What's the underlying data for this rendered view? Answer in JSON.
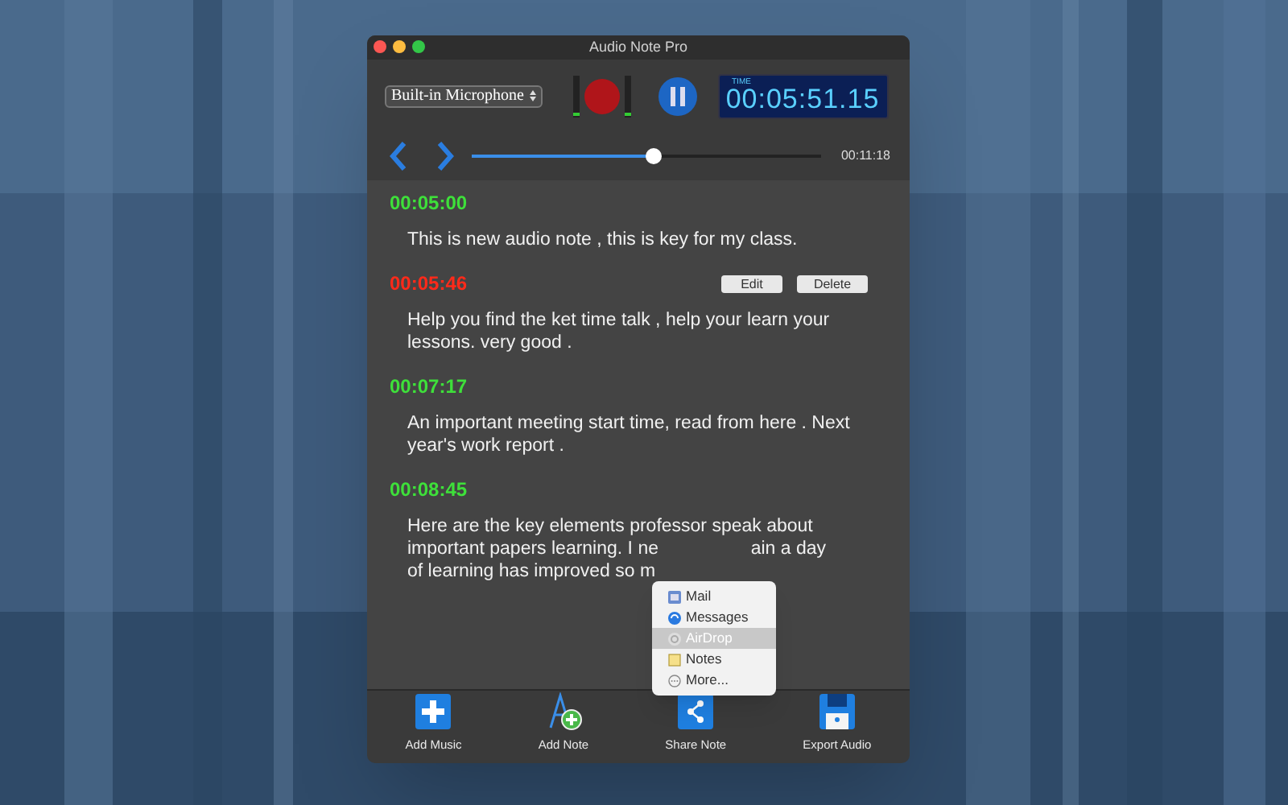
{
  "window": {
    "title": "Audio Note Pro"
  },
  "toolbar": {
    "input_source": "Built-in Microphone",
    "timer_label": "TIME",
    "timer": "00:05:51.15"
  },
  "playback": {
    "level": 0.52,
    "duration": "00:11:18"
  },
  "notes": [
    {
      "time": "00:05:00",
      "selected": false,
      "lines": [
        [
          "This is new audio note , this is key for my class."
        ]
      ]
    },
    {
      "time": "00:05:46",
      "selected": true,
      "actions": [
        "Edit",
        "Delete"
      ],
      "lines": [
        [
          "Help you find the ket time talk , help your learn your"
        ],
        [
          "lessons. very good ."
        ]
      ]
    },
    {
      "time": "00:07:17",
      "selected": false,
      "lines": [
        [
          "An important meeting start time, read from here . Next"
        ],
        [
          "year's work report ."
        ]
      ]
    },
    {
      "time": "00:08:45",
      "selected": false,
      "lines": [
        [
          "Here are the key elements professor speak about"
        ],
        [
          "important papers learning. I ne",
          "ain a day"
        ],
        [
          "of learning has improved so m"
        ]
      ]
    }
  ],
  "share_menu": [
    {
      "kind": "mail",
      "label": "Mail",
      "selected": false
    },
    {
      "kind": "messages",
      "label": "Messages",
      "selected": false
    },
    {
      "kind": "airdrop",
      "label": "AirDrop",
      "selected": true
    },
    {
      "kind": "notes",
      "label": "Notes",
      "selected": false
    },
    {
      "kind": "more",
      "label": "More...",
      "selected": false
    }
  ],
  "bottom_bar": [
    {
      "kind": "add_music",
      "label": "Add Music"
    },
    {
      "kind": "add_note",
      "label": "Add Note"
    },
    {
      "kind": "share",
      "label": "Share Note"
    },
    {
      "kind": "export",
      "label": "Export Audio"
    }
  ]
}
